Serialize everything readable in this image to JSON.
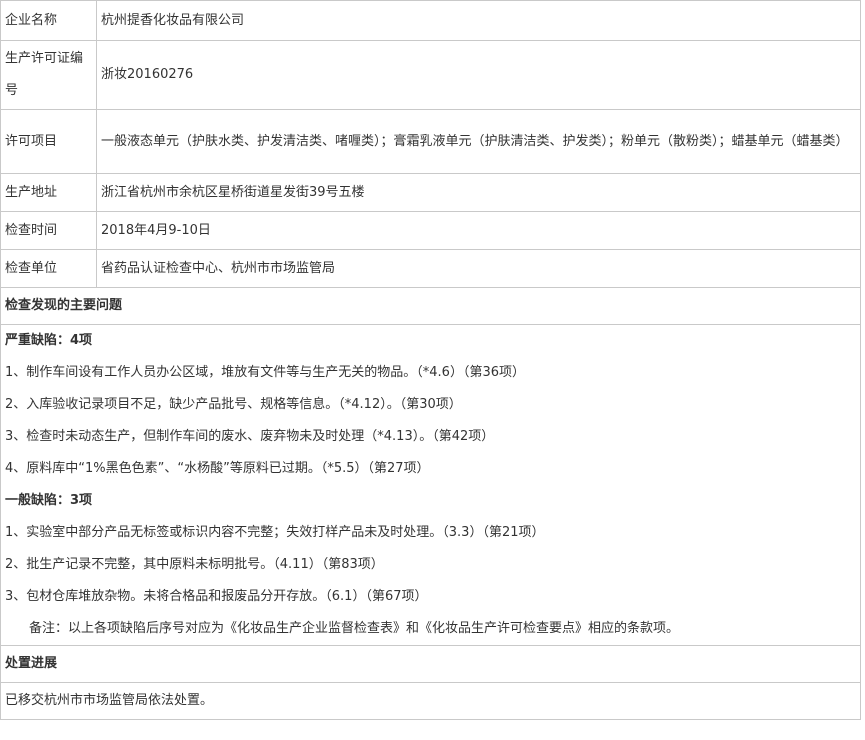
{
  "info": {
    "rows": [
      {
        "label": "企业名称",
        "value": "杭州提香化妆品有限公司"
      },
      {
        "label": "生产许可证编号",
        "value": "浙妆20160276"
      },
      {
        "label": "许可项目",
        "value": "一般液态单元（护肤水类、护发清洁类、啫喱类）；膏霜乳液单元（护肤清洁类、护发类）；粉单元（散粉类）；蜡基单元（蜡基类）"
      },
      {
        "label": "生产地址",
        "value": "浙江省杭州市余杭区星桥街道星发街39号五楼"
      },
      {
        "label": "检查时间",
        "value": "2018年4月9-10日"
      },
      {
        "label": "检查单位",
        "value": "省药品认证检查中心、杭州市市场监管局"
      }
    ]
  },
  "problems": {
    "heading": "检查发现的主要问题",
    "serious_title": "严重缺陷：4项",
    "serious_items": [
      "1、制作车间设有工作人员办公区域，堆放有文件等与生产无关的物品。（*4.6）（第36项）",
      "2、入库验收记录项目不足，缺少产品批号、规格等信息。（*4.12）。（第30项）",
      "3、检查时未动态生产，但制作车间的废水、废弃物未及时处理（*4.13）。（第42项）",
      "4、原料库中“1%黑色色素”、“水杨酸”等原料已过期。（*5.5）（第27项）"
    ],
    "general_title": "一般缺陷：3项",
    "general_items": [
      "1、实验室中部分产品无标签或标识内容不完整；失效打样产品未及时处理。（3.3）（第21项）",
      "2、批生产记录不完整，其中原料未标明批号。（4.11）（第83项）",
      "3、包材仓库堆放杂物。未将合格品和报废品分开存放。（6.1）（第67项）"
    ],
    "note": "备注：以上各项缺陷后序号对应为《化妆品生产企业监督检查表》和《化妆品生产许可检查要点》相应的条款项。"
  },
  "disposal": {
    "heading": "处置进展",
    "text": "已移交杭州市市场监管局依法处置。"
  }
}
